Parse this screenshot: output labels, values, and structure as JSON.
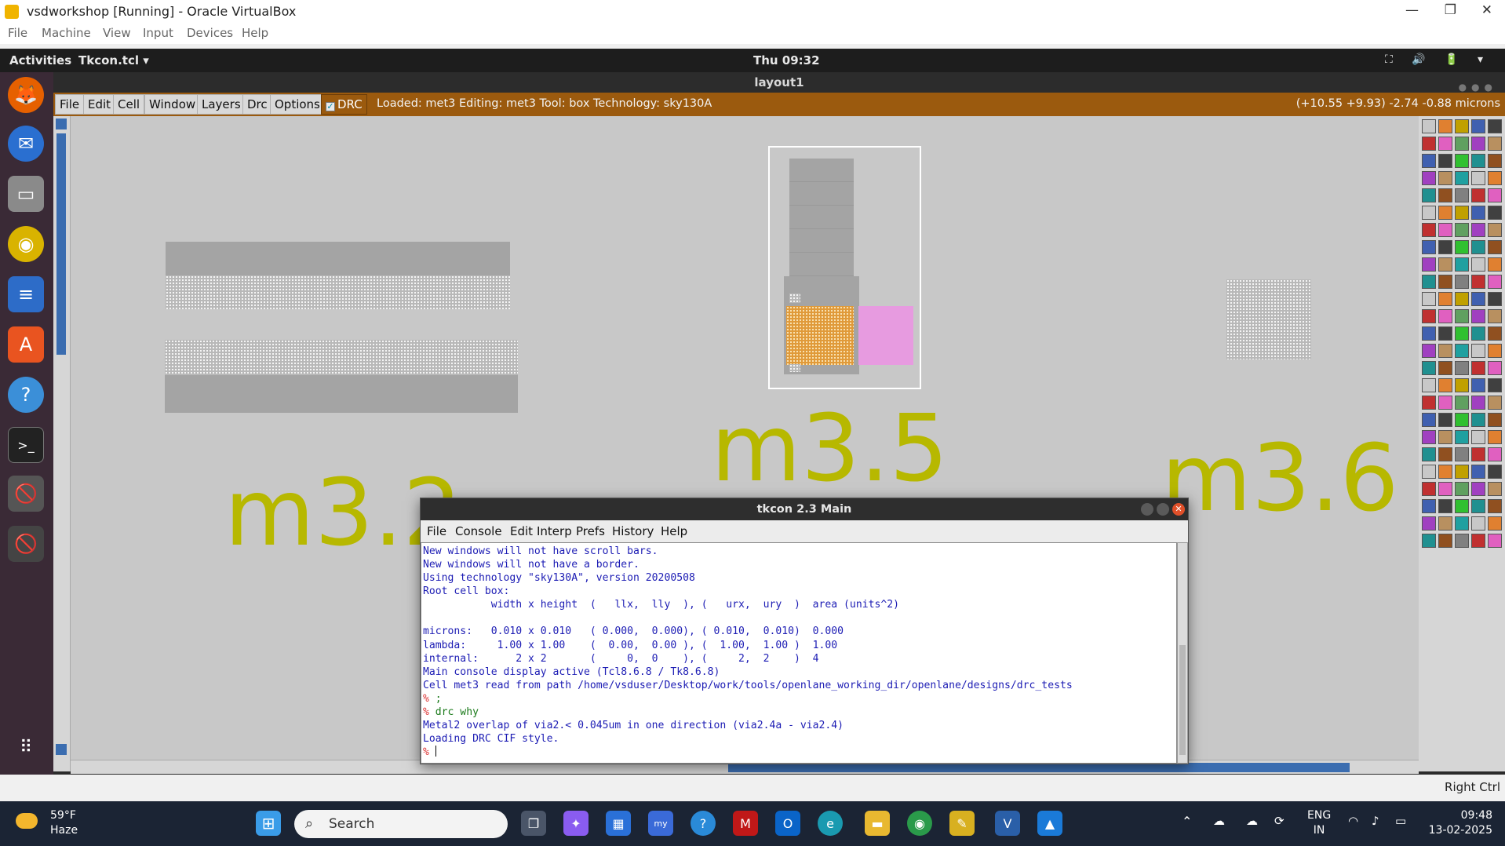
{
  "vbox": {
    "title": "vsdworkshop [Running] - Oracle VirtualBox",
    "menu": [
      "File",
      "Machine",
      "View",
      "Input",
      "Devices",
      "Help"
    ],
    "right_ctrl": "Right Ctrl"
  },
  "gnome": {
    "activities": "Activities",
    "app_menu": "Tkcon.tcl ▾",
    "clock": "Thu 09:32",
    "tray": "⛶ 🔊 🔋 ▾"
  },
  "layout_window": {
    "title": "layout1",
    "buttons": [
      "File",
      "Edit",
      "Cell",
      "Window",
      "Layers",
      "Drc",
      "Options"
    ],
    "drc_toggle": "DRC",
    "status": "Loaded: met3  Editing: met3  Tool: box   Technology: sky130A",
    "coords": "(+10.55 +9.93) -2.74 -0.88 microns",
    "labels": [
      "m3.2",
      "m3.5",
      "m3.6"
    ]
  },
  "tkcon": {
    "title": "tkcon 2.3 Main",
    "menu": [
      "File",
      "Console",
      "Edit",
      "Interp",
      "Prefs",
      "History",
      "Help"
    ],
    "lines": [
      "New windows will not have scroll bars.",
      "New windows will not have a border.",
      "Using technology \"sky130A\", version 20200508",
      "Root cell box:",
      "           width x height  (   llx,  lly  ), (   urx,  ury  )  area (units^2)",
      "",
      "microns:   0.010 x 0.010   ( 0.000,  0.000), ( 0.010,  0.010)  0.000",
      "lambda:     1.00 x 1.00    (  0.00,  0.00 ), (  1.00,  1.00 )  1.00",
      "internal:      2 x 2       (     0,  0    ), (     2,  2    )  4",
      "Main console display active (Tcl8.6.8 / Tk8.6.8)",
      "Cell met3 read from path /home/vsduser/Desktop/work/tools/openlane_working_dir/openlane/designs/drc_tests"
    ],
    "prompt": "%",
    "cmd1": " ;",
    "cmd2": " drc why",
    "out1": "Metal2 overlap of via2.< 0.045um in one direction (via2.4a - via2.4)",
    "out2": "Loading DRC CIF style."
  },
  "taskbar": {
    "temp": "59°F",
    "weather": "Haze",
    "search": "Search",
    "lang1": "ENG",
    "lang2": "IN",
    "time": "09:48",
    "date": "13-02-2025"
  },
  "colors": {
    "magic_toolbar": "#9b5a0e",
    "label_yellow": "#b7b800",
    "via_orange": "#e09a3a",
    "metal_pink": "#e79be0",
    "console_blue": "#1c1cb4",
    "dock_bg": "#3a2a36"
  }
}
